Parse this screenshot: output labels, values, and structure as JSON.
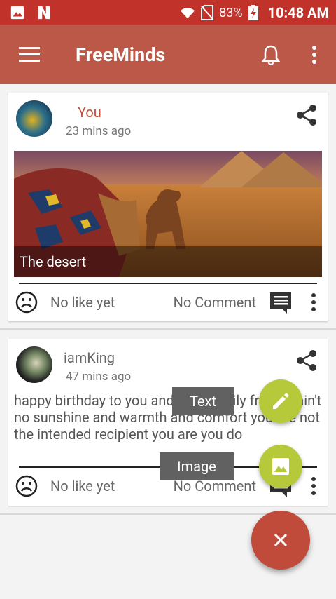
{
  "status_bar": {
    "battery": "83%",
    "time": "10:48 AM"
  },
  "app_bar": {
    "title": "FreeMinds"
  },
  "posts": [
    {
      "author": "You",
      "time": "23 mins ago",
      "caption": "The desert",
      "likes": "No like yet",
      "comments": "No Comment"
    },
    {
      "author": "iamKing",
      "time": "47 mins ago",
      "text": "happy birthday to you and your family friends ain't no sunshine and warmth and comfort you are not the intended recipient you are you do",
      "likes": "No like yet",
      "comments": "No Comment"
    }
  ],
  "fab_menu": {
    "text_label": "Text",
    "image_label": "Image"
  },
  "colors": {
    "status_bar": "#c0322a",
    "app_bar": "#bb5847",
    "accent_author": "#c0503c",
    "fab_mini": "#b6c93a",
    "fab_main": "#c04b3a"
  },
  "icons": [
    "gallery-icon",
    "n-logo-icon",
    "wifi-icon",
    "no-sim-icon",
    "battery-charging-icon",
    "menu-icon",
    "bell-icon",
    "overflow-icon",
    "share-icon",
    "sad-face-icon",
    "comment-icon",
    "pencil-icon",
    "image-icon",
    "close-icon"
  ]
}
